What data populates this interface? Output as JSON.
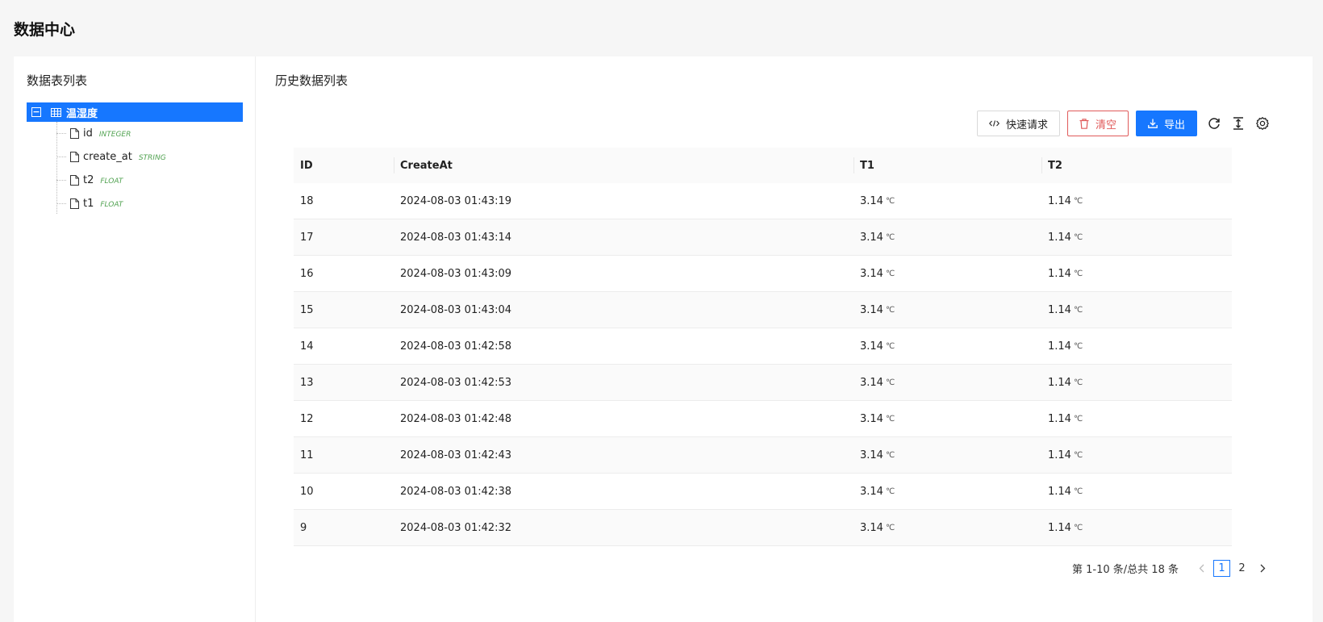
{
  "header": {
    "title": "数据中心"
  },
  "sidebar": {
    "title": "数据表列表",
    "tree": {
      "root": {
        "label": "温湿度",
        "expanded": true,
        "selected": true
      },
      "children": [
        {
          "name": "id",
          "type": "INTEGER"
        },
        {
          "name": "create_at",
          "type": "STRING"
        },
        {
          "name": "t2",
          "type": "FLOAT"
        },
        {
          "name": "t1",
          "type": "FLOAT"
        }
      ]
    }
  },
  "main": {
    "title": "历史数据列表",
    "toolbar": {
      "quick_request": "快速请求",
      "clear": "清空",
      "export": "导出"
    },
    "table": {
      "columns": [
        "ID",
        "CreateAt",
        "T1",
        "T2"
      ],
      "unit": "℃",
      "rows": [
        {
          "id": "18",
          "create_at": "2024-08-03 01:43:19",
          "t1": "3.14",
          "t2": "1.14"
        },
        {
          "id": "17",
          "create_at": "2024-08-03 01:43:14",
          "t1": "3.14",
          "t2": "1.14"
        },
        {
          "id": "16",
          "create_at": "2024-08-03 01:43:09",
          "t1": "3.14",
          "t2": "1.14"
        },
        {
          "id": "15",
          "create_at": "2024-08-03 01:43:04",
          "t1": "3.14",
          "t2": "1.14"
        },
        {
          "id": "14",
          "create_at": "2024-08-03 01:42:58",
          "t1": "3.14",
          "t2": "1.14"
        },
        {
          "id": "13",
          "create_at": "2024-08-03 01:42:53",
          "t1": "3.14",
          "t2": "1.14"
        },
        {
          "id": "12",
          "create_at": "2024-08-03 01:42:48",
          "t1": "3.14",
          "t2": "1.14"
        },
        {
          "id": "11",
          "create_at": "2024-08-03 01:42:43",
          "t1": "3.14",
          "t2": "1.14"
        },
        {
          "id": "10",
          "create_at": "2024-08-03 01:42:38",
          "t1": "3.14",
          "t2": "1.14"
        },
        {
          "id": "9",
          "create_at": "2024-08-03 01:42:32",
          "t1": "3.14",
          "t2": "1.14"
        }
      ]
    },
    "pagination": {
      "summary": "第 1-10 条/总共 18 条",
      "pages": [
        "1",
        "2"
      ],
      "current": "1"
    }
  },
  "colors": {
    "primary": "#1677ff",
    "danger": "#e05a5a",
    "type_tag": "#52a352"
  }
}
